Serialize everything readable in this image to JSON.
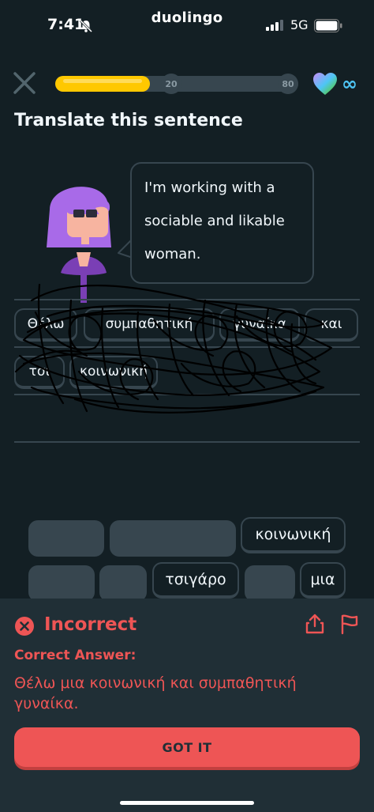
{
  "status_bar": {
    "time": "7:41",
    "app_name": "duolingo",
    "network": "5G",
    "icons": [
      "bell-slash-icon",
      "signal-icon",
      "battery-icon"
    ]
  },
  "header": {
    "progress_fraction": 0.39,
    "milestones": [
      "20",
      "80"
    ],
    "hearts": "∞",
    "icons": [
      "close-icon",
      "heart-icon",
      "infinity-icon"
    ],
    "colors": {
      "progress": "#ffc800",
      "background": "#131f24",
      "track": "#37464f"
    }
  },
  "prompt": {
    "title": "Translate this sentence",
    "sentence": "I'm working with a sociable and likable woman."
  },
  "answer_tiles": [
    "Θέλω",
    "συμπαθητική",
    "γυναίκα",
    "και",
    "τσι",
    "κοινωνική"
  ],
  "word_bank": {
    "available": [
      "κοινωνική",
      "τσιγάρο",
      "μια"
    ]
  },
  "feedback": {
    "status": "Incorrect",
    "label": "Correct Answer:",
    "answer": "Θέλω μια κοινωνική και συμπαθητική γυναίκα.",
    "button": "GOT IT",
    "colors": {
      "error": "#ee5555",
      "panel": "#202f36"
    },
    "icons": [
      "error-x-icon",
      "share-icon",
      "flag-icon"
    ]
  }
}
